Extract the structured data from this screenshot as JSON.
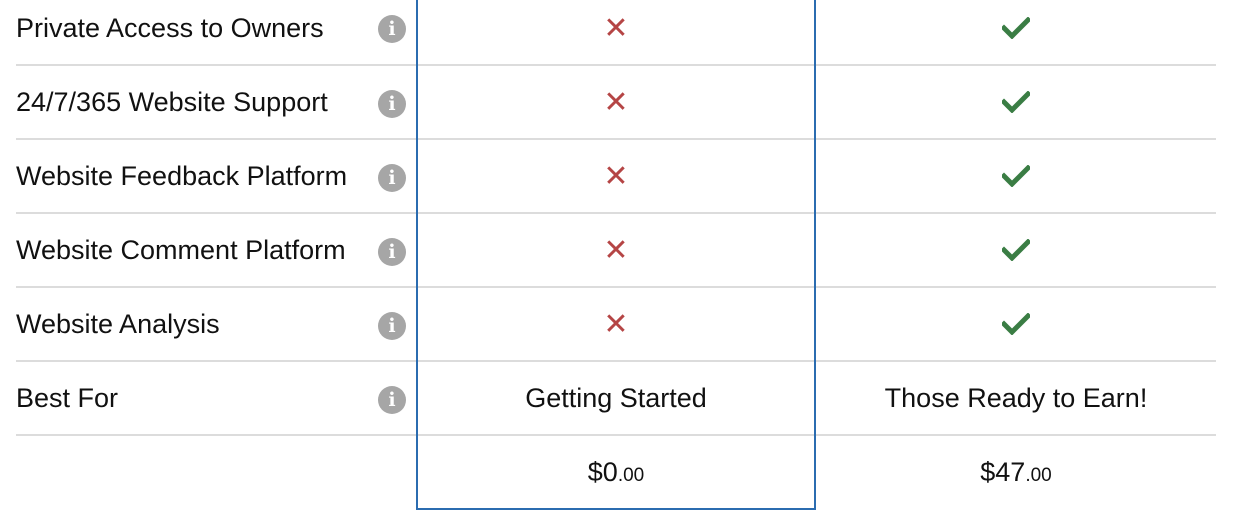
{
  "features": [
    {
      "label": "Private Access to Owners",
      "free": "✕",
      "pro": "check"
    },
    {
      "label": "24/7/365 Website Support",
      "free": "✕",
      "pro": "check"
    },
    {
      "label": "Website Feedback Platform",
      "free": "✕",
      "pro": "check"
    },
    {
      "label": "Website Comment Platform",
      "free": "✕",
      "pro": "check"
    },
    {
      "label": "Website Analysis",
      "free": "✕",
      "pro": "check"
    }
  ],
  "best_for": {
    "label": "Best For",
    "free": "Getting Started",
    "pro": "Those Ready to Earn!"
  },
  "pricing": {
    "free_dollars": "$0",
    "free_cents": ".00",
    "pro_dollars": "$47",
    "pro_cents": ".00"
  },
  "icons": {
    "info": "info-icon",
    "cross": "cross-icon",
    "check": "check-icon"
  },
  "colors": {
    "cross": "#b54545",
    "check": "#3a7d44",
    "highlight_border": "#2b6cb0",
    "info_icon": "#a6a6a6"
  }
}
